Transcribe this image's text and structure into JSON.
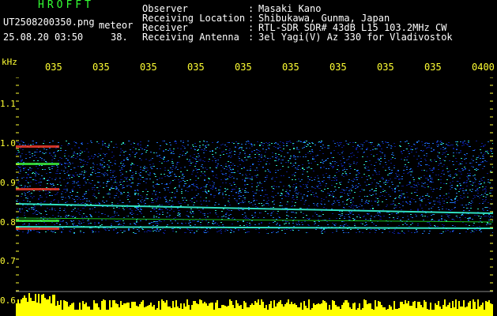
{
  "header": {
    "brand": "HROFFT",
    "file_name": "UT2508200350.png",
    "file_type": "meteor",
    "date_time": "25.08.20 03:50",
    "count": "38.",
    "fields": [
      {
        "label": "Observer",
        "value": "Masaki Kano"
      },
      {
        "label": "Receiving Location",
        "value": "Shibukawa, Gunma, Japan"
      },
      {
        "label": "Receiver",
        "value": "RTL-SDR SDR# 43dB L15 103.2MHz CW"
      },
      {
        "label": "Receiving Antenna",
        "value": "3el Yagi(V) Az 330 for Vladivostok"
      }
    ]
  },
  "axes": {
    "y_unit": "kHz",
    "y_ticks": [
      "1.1",
      "1.0",
      "0.9",
      "0.8",
      "0.7",
      "0.6"
    ],
    "x_ticks": [
      "035",
      "035",
      "035",
      "035",
      "035",
      "035",
      "035",
      "035",
      "035",
      "0400"
    ]
  },
  "colors": {
    "background": "#000000",
    "axis_text": "#ffff33",
    "header_text": "#ffffff",
    "brand_text": "#33ff33",
    "noise_low": "#0a1a8c",
    "noise_mid": "#1e6fe0",
    "noise_high": "#2fe0c0",
    "signal": "#ff4030",
    "level_bars": "#ffff00"
  }
}
